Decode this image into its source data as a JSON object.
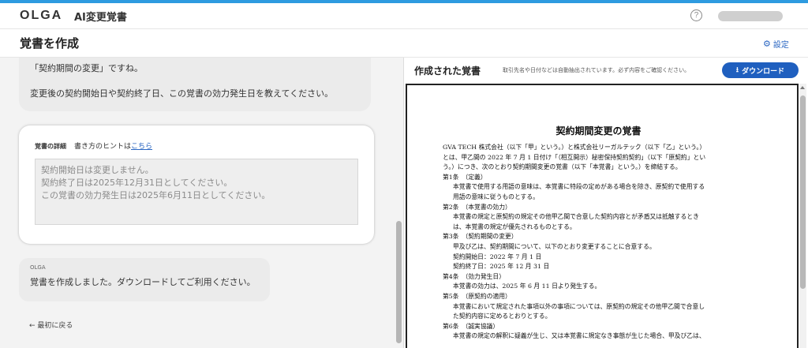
{
  "header": {
    "logo": "OLGA",
    "app_title": "AI変更覚書",
    "help_icon": "question-circle-icon"
  },
  "subheader": {
    "page_title": "覚書を作成",
    "settings_label": "設定",
    "settings_icon": "gear-icon"
  },
  "chat": {
    "bubble1_line1": "「契約期間の変更」ですね。",
    "bubble1_line2": "変更後の契約開始日や契約終了日、この覚書の効力発生日を教えてください。",
    "detail_title": "覚書の詳細",
    "detail_hint_prefix": "書き方のヒントは",
    "detail_hint_link": "こちら",
    "detail_lines": [
      "契約開始日は変更しません。",
      "契約終了日は2025年12月31日としてください。",
      "この覚書の効力発生日は2025年6月11日としてください。"
    ],
    "olga_sender": "OLGA",
    "olga_message": "覚書を作成しました。ダウンロードしてご利用ください。",
    "back_label": "← 最初に戻る"
  },
  "preview": {
    "title": "作成された覚書",
    "note": "取引先名や日付などは自動抽出されています。必ず内容をご確認ください。",
    "download_label": "ダウンロード",
    "download_icon": "download-icon",
    "doc_title": "契約期間変更の覚書",
    "doc_lines": [
      {
        "cls": "",
        "text": "GVA TECH 株式会社（以下「甲」という。）と株式会社リーガルテック（以下「乙」という。）"
      },
      {
        "cls": "",
        "text": "とは、甲乙間の 2022 年 7 月 1 日付け「（相互開示）秘密保持契約契約」（以下「原契約」とい"
      },
      {
        "cls": "",
        "text": "う。）につき、次のとおり契約期間変更の覚書（以下「本覚書」という。）を締結する。"
      },
      {
        "cls": "",
        "text": "第1条　（定義）"
      },
      {
        "cls": "ind",
        "text": "本覚書で使用する用語の意味は、本覚書に特段の定めがある場合を除き、原契約で使用する"
      },
      {
        "cls": "ind",
        "text": "用語の意味に従うものとする。"
      },
      {
        "cls": "",
        "text": "第2条　（本覚書の効力）"
      },
      {
        "cls": "ind",
        "text": "本覚書の規定と原契約の規定その他甲乙間で合意した契約内容とが矛盾又は抵触するとき"
      },
      {
        "cls": "ind",
        "text": "は、本覚書の規定が優先されるものとする。"
      },
      {
        "cls": "",
        "text": "第3条　（契約期間の変更）"
      },
      {
        "cls": "ind",
        "text": "甲及び乙は、契約期間について、以下のとおり変更することに合意する。"
      },
      {
        "cls": "ind",
        "text": "契約開始日：2022 年 7 月 1 日"
      },
      {
        "cls": "ind",
        "text": "契約終了日：2025 年 12 月 31 日"
      },
      {
        "cls": "",
        "text": "第4条　（効力発生日）"
      },
      {
        "cls": "ind",
        "text": "本覚書の効力は、2025 年 6 月 11 日より発生する。"
      },
      {
        "cls": "",
        "text": "第5条　（原契約の適用）"
      },
      {
        "cls": "ind",
        "text": "本覚書において規定された事項以外の事項については、原契約の規定その他甲乙間で合意し"
      },
      {
        "cls": "ind",
        "text": "た契約内容に定めるとおりとする。"
      },
      {
        "cls": "",
        "text": "第6条　（誠実協議）"
      },
      {
        "cls": "ind",
        "text": "本覚書の規定の解釈に疑義が生じ、又は本覚書に規定なき事態が生じた場合、甲及び乙は、"
      }
    ]
  }
}
